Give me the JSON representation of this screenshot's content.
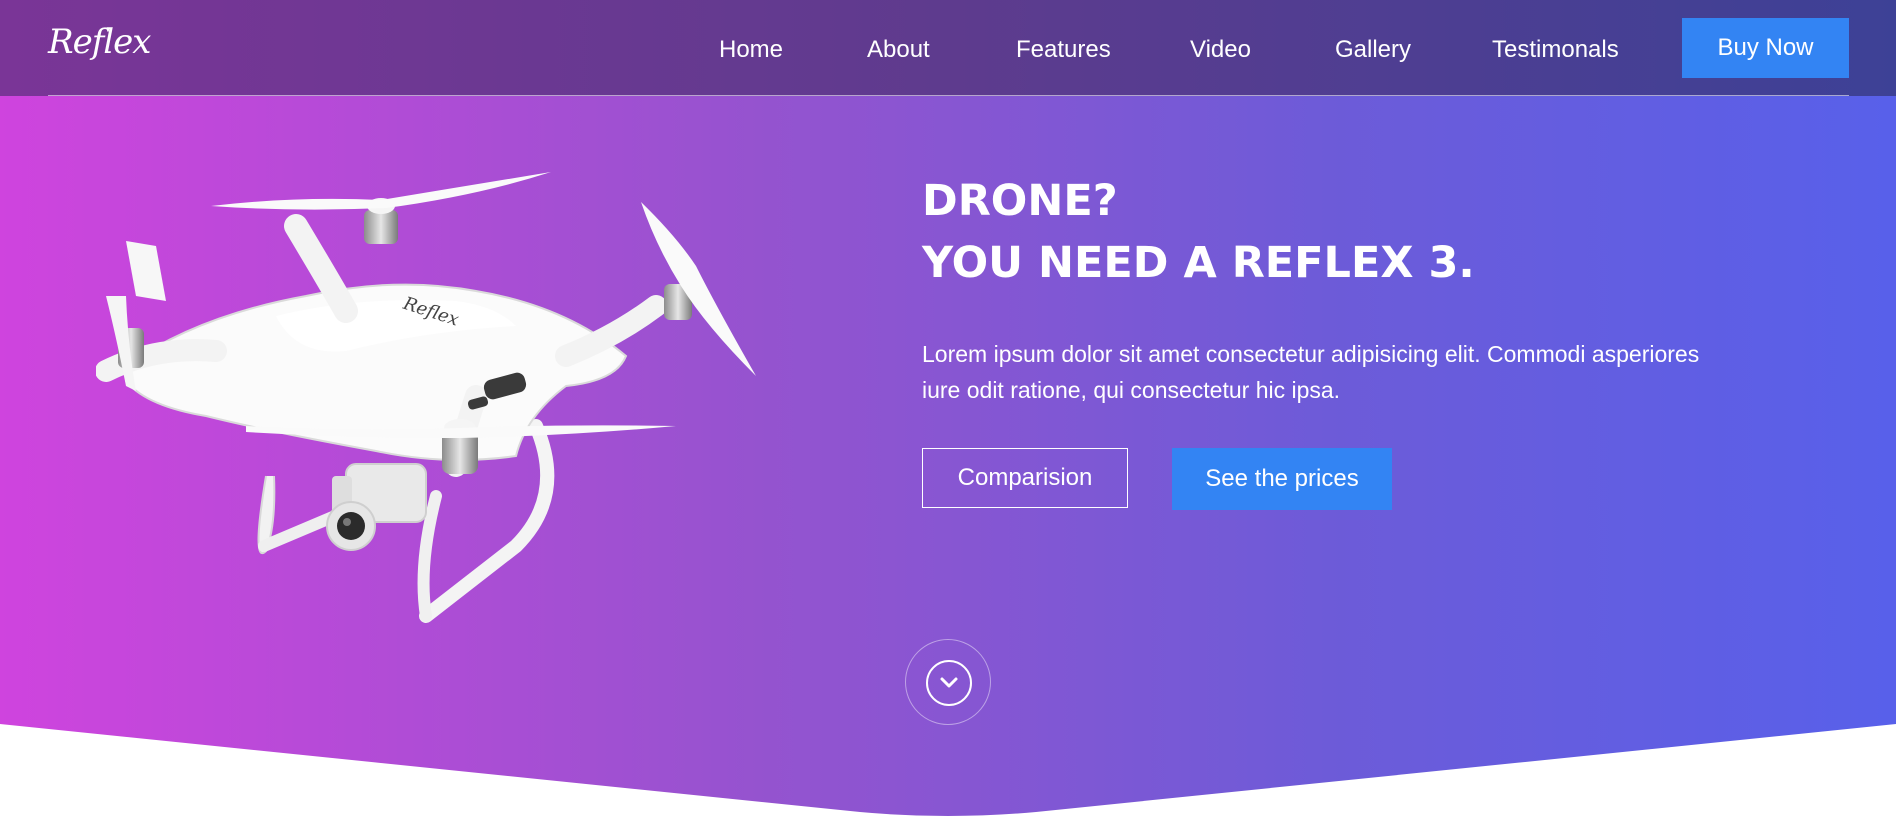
{
  "brand": {
    "logo_text": "Reflex",
    "product_logo_text": "Reflex"
  },
  "nav": {
    "items": [
      {
        "label": "Home"
      },
      {
        "label": "About"
      },
      {
        "label": "Features"
      },
      {
        "label": "Video"
      },
      {
        "label": "Gallery"
      },
      {
        "label": "Testimonals"
      }
    ],
    "cta_label": "Buy Now"
  },
  "hero": {
    "headline_line1": "DRONE?",
    "headline_line2": "YOU NEED A REFLEX 3.",
    "description": "Lorem ipsum dolor sit amet consectetur adipisicing elit. Commodi asperiores iure odit ratione, qui consectetur hic ipsa.",
    "primary_button": "Comparision",
    "secondary_button": "See the prices",
    "scroll_icon": "chevron-down-icon"
  },
  "colors": {
    "accent_button": "#3384f3",
    "gradient_left": "#cf44de",
    "gradient_right": "#5860ea",
    "text": "#ffffff"
  }
}
